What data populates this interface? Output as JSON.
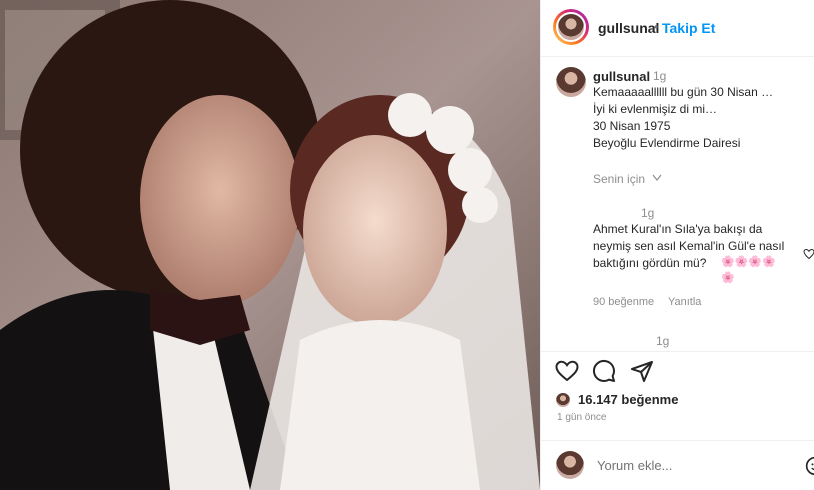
{
  "post": {
    "username": "gullsunal",
    "follow_separator": "•",
    "follow_label": "Takip Et"
  },
  "caption": {
    "username": "gullsunal",
    "time": "1g",
    "lines": [
      "Kemaaaaallllll bu gün 30 Nisan …",
      "İyi ki evlenmişiz di mi…",
      "30 Nisan 1975",
      "Beyoğlu Evlendirme Dairesi"
    ],
    "translate_label": "Senin için"
  },
  "comments": [
    {
      "time": "1g",
      "text_lines": [
        "Ahmet Kural'ın Sıla'ya bakışı da",
        "neymiş sen asıl Kemal'in Gül'e nasıl",
        "baktığını gördün mü?"
      ],
      "emoji": "🌸🌸🌸🌸🌸",
      "likes_label": "90 beğenme",
      "reply_label": "Yanıtla"
    },
    {
      "time": "1g"
    }
  ],
  "actions": {
    "like_icon": "heart-icon",
    "comment_icon": "comment-icon",
    "share_icon": "send-icon"
  },
  "likes": {
    "count_label": "16.147 beğenme",
    "time_ago": "1 gün önce"
  },
  "comment_box": {
    "placeholder": "Yorum ekle..."
  },
  "colors": {
    "follow": "#0095f6",
    "text": "#262626",
    "muted": "#8e8e8e"
  }
}
